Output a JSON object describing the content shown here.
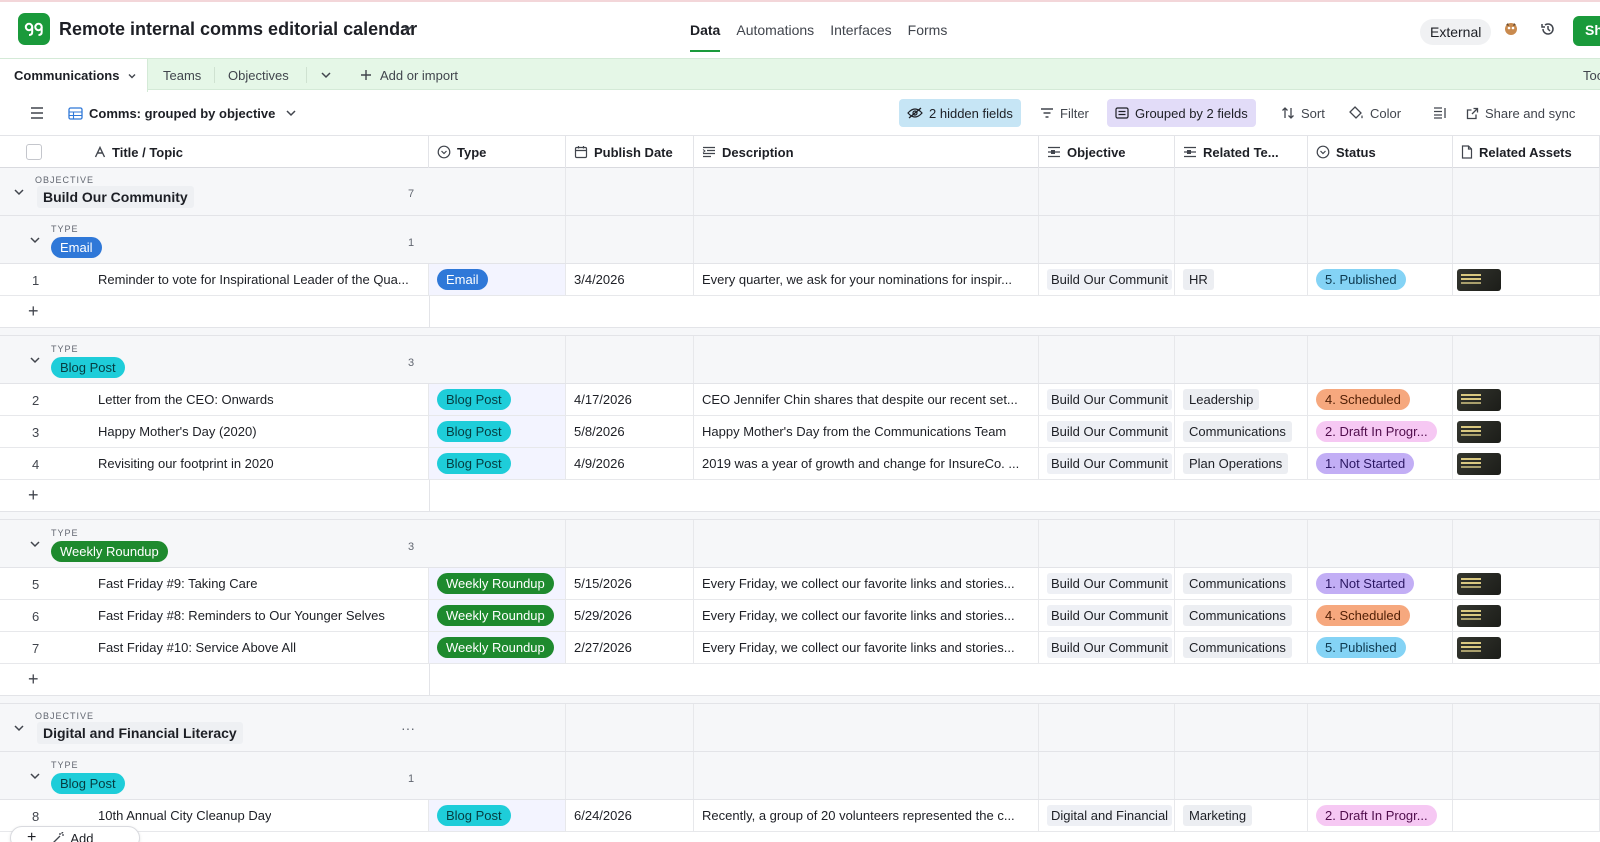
{
  "app": {
    "base_title": "Remote internal comms editorial calendar",
    "main_tabs": [
      {
        "label": "Data"
      },
      {
        "label": "Automations"
      },
      {
        "label": "Interfaces"
      },
      {
        "label": "Forms"
      }
    ],
    "external_label": "External",
    "share_label": "Sh",
    "brand_color": "#1a9a3b"
  },
  "tables": {
    "items": [
      {
        "label": "Communications"
      },
      {
        "label": "Teams"
      },
      {
        "label": "Objectives"
      }
    ],
    "add_label": "Add or import",
    "tools_label": "Too"
  },
  "viewbar": {
    "view_name": "Comms: grouped by objective",
    "hidden_fields": "2 hidden fields",
    "filter": "Filter",
    "grouped": "Grouped by 2 fields",
    "sort": "Sort",
    "color": "Color",
    "share_sync": "Share and sync"
  },
  "columns": {
    "title": "Title / Topic",
    "type": "Type",
    "publish_date": "Publish Date",
    "description": "Description",
    "objective": "Objective",
    "related_teams": "Related Te...",
    "status": "Status",
    "related_assets": "Related Assets"
  },
  "group_labels": {
    "objective": "OBJECTIVE",
    "type": "TYPE"
  },
  "groups": {
    "g1": {
      "name": "Build Our Community",
      "count": "7"
    },
    "g1_email": {
      "name": "Email",
      "count": "1"
    },
    "g1_blog": {
      "name": "Blog Post",
      "count": "3"
    },
    "g1_weekly": {
      "name": "Weekly Roundup",
      "count": "3"
    },
    "g2": {
      "name": "Digital and Financial Literacy",
      "more": "···"
    },
    "g2_blog": {
      "name": "Blog Post",
      "count": "1"
    }
  },
  "records": [
    {
      "num": "1",
      "title": "Reminder to vote for Inspirational Leader of the Qua...",
      "type": "Email",
      "date": "3/4/2026",
      "description": "Every quarter, we ask for your nominations for inspir...",
      "objective": "Build Our Communit",
      "team": "HR",
      "status": "5. Published"
    },
    {
      "num": "2",
      "title": "Letter from the CEO: Onwards",
      "type": "Blog Post",
      "date": "4/17/2026",
      "description": "CEO Jennifer Chin shares that despite our recent set...",
      "objective": "Build Our Communit",
      "team": "Leadership",
      "status": "4. Scheduled"
    },
    {
      "num": "3",
      "title": "Happy Mother's Day (2020)",
      "type": "Blog Post",
      "date": "5/8/2026",
      "description": "Happy Mother's Day from the Communications Team",
      "objective": "Build Our Communit",
      "team": "Communications",
      "status": "2. Draft In Progr..."
    },
    {
      "num": "4",
      "title": "Revisiting our footprint in 2020",
      "type": "Blog Post",
      "date": "4/9/2026",
      "description": "2019 was a year of growth and change for InsureCo. ...",
      "objective": "Build Our Communit",
      "team": "Plan Operations",
      "status": "1. Not Started"
    },
    {
      "num": "5",
      "title": "Fast Friday #9: Taking Care",
      "type": "Weekly Roundup",
      "date": "5/15/2026",
      "description": "Every Friday, we collect our favorite links and stories...",
      "objective": "Build Our Communit",
      "team": "Communications",
      "status": "1. Not Started"
    },
    {
      "num": "6",
      "title": "Fast Friday #8: Reminders to Our Younger Selves",
      "type": "Weekly Roundup",
      "date": "5/29/2026",
      "description": "Every Friday, we collect our favorite links and stories...",
      "objective": "Build Our Communit",
      "team": "Communications",
      "status": "4. Scheduled"
    },
    {
      "num": "7",
      "title": "Fast Friday #10: Service Above All",
      "type": "Weekly Roundup",
      "date": "2/27/2026",
      "description": "Every Friday, we collect our favorite links and stories...",
      "objective": "Build Our Communit",
      "team": "Communications",
      "status": "5. Published"
    },
    {
      "num": "8",
      "title": "10th Annual City Cleanup Day",
      "type": "Blog Post",
      "date": "6/24/2026",
      "description": "Recently, a group of 20 volunteers represented the c...",
      "objective": "Digital and Financial",
      "team": "Marketing",
      "status": "2. Draft In Progr..."
    }
  ],
  "footer": {
    "add_label": "Add"
  },
  "colors": {
    "email": "#2f78d8",
    "blog_post": "#1ecdd9",
    "weekly_roundup": "#1e8a2e",
    "published": "#84d3f5",
    "scheduled": "#f6a87e",
    "draft": "#f6c8f3",
    "not_started": "#c2aef5"
  }
}
